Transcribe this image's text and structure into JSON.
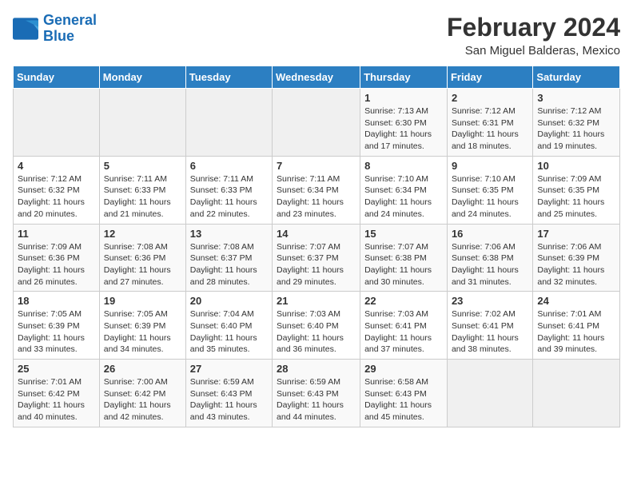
{
  "logo": {
    "line1": "General",
    "line2": "Blue"
  },
  "title": "February 2024",
  "location": "San Miguel Balderas, Mexico",
  "days_header": [
    "Sunday",
    "Monday",
    "Tuesday",
    "Wednesday",
    "Thursday",
    "Friday",
    "Saturday"
  ],
  "weeks": [
    [
      {
        "day": "",
        "info": ""
      },
      {
        "day": "",
        "info": ""
      },
      {
        "day": "",
        "info": ""
      },
      {
        "day": "",
        "info": ""
      },
      {
        "day": "1",
        "info": "Sunrise: 7:13 AM\nSunset: 6:30 PM\nDaylight: 11 hours and 17 minutes."
      },
      {
        "day": "2",
        "info": "Sunrise: 7:12 AM\nSunset: 6:31 PM\nDaylight: 11 hours and 18 minutes."
      },
      {
        "day": "3",
        "info": "Sunrise: 7:12 AM\nSunset: 6:32 PM\nDaylight: 11 hours and 19 minutes."
      }
    ],
    [
      {
        "day": "4",
        "info": "Sunrise: 7:12 AM\nSunset: 6:32 PM\nDaylight: 11 hours and 20 minutes."
      },
      {
        "day": "5",
        "info": "Sunrise: 7:11 AM\nSunset: 6:33 PM\nDaylight: 11 hours and 21 minutes."
      },
      {
        "day": "6",
        "info": "Sunrise: 7:11 AM\nSunset: 6:33 PM\nDaylight: 11 hours and 22 minutes."
      },
      {
        "day": "7",
        "info": "Sunrise: 7:11 AM\nSunset: 6:34 PM\nDaylight: 11 hours and 23 minutes."
      },
      {
        "day": "8",
        "info": "Sunrise: 7:10 AM\nSunset: 6:34 PM\nDaylight: 11 hours and 24 minutes."
      },
      {
        "day": "9",
        "info": "Sunrise: 7:10 AM\nSunset: 6:35 PM\nDaylight: 11 hours and 24 minutes."
      },
      {
        "day": "10",
        "info": "Sunrise: 7:09 AM\nSunset: 6:35 PM\nDaylight: 11 hours and 25 minutes."
      }
    ],
    [
      {
        "day": "11",
        "info": "Sunrise: 7:09 AM\nSunset: 6:36 PM\nDaylight: 11 hours and 26 minutes."
      },
      {
        "day": "12",
        "info": "Sunrise: 7:08 AM\nSunset: 6:36 PM\nDaylight: 11 hours and 27 minutes."
      },
      {
        "day": "13",
        "info": "Sunrise: 7:08 AM\nSunset: 6:37 PM\nDaylight: 11 hours and 28 minutes."
      },
      {
        "day": "14",
        "info": "Sunrise: 7:07 AM\nSunset: 6:37 PM\nDaylight: 11 hours and 29 minutes."
      },
      {
        "day": "15",
        "info": "Sunrise: 7:07 AM\nSunset: 6:38 PM\nDaylight: 11 hours and 30 minutes."
      },
      {
        "day": "16",
        "info": "Sunrise: 7:06 AM\nSunset: 6:38 PM\nDaylight: 11 hours and 31 minutes."
      },
      {
        "day": "17",
        "info": "Sunrise: 7:06 AM\nSunset: 6:39 PM\nDaylight: 11 hours and 32 minutes."
      }
    ],
    [
      {
        "day": "18",
        "info": "Sunrise: 7:05 AM\nSunset: 6:39 PM\nDaylight: 11 hours and 33 minutes."
      },
      {
        "day": "19",
        "info": "Sunrise: 7:05 AM\nSunset: 6:39 PM\nDaylight: 11 hours and 34 minutes."
      },
      {
        "day": "20",
        "info": "Sunrise: 7:04 AM\nSunset: 6:40 PM\nDaylight: 11 hours and 35 minutes."
      },
      {
        "day": "21",
        "info": "Sunrise: 7:03 AM\nSunset: 6:40 PM\nDaylight: 11 hours and 36 minutes."
      },
      {
        "day": "22",
        "info": "Sunrise: 7:03 AM\nSunset: 6:41 PM\nDaylight: 11 hours and 37 minutes."
      },
      {
        "day": "23",
        "info": "Sunrise: 7:02 AM\nSunset: 6:41 PM\nDaylight: 11 hours and 38 minutes."
      },
      {
        "day": "24",
        "info": "Sunrise: 7:01 AM\nSunset: 6:41 PM\nDaylight: 11 hours and 39 minutes."
      }
    ],
    [
      {
        "day": "25",
        "info": "Sunrise: 7:01 AM\nSunset: 6:42 PM\nDaylight: 11 hours and 40 minutes."
      },
      {
        "day": "26",
        "info": "Sunrise: 7:00 AM\nSunset: 6:42 PM\nDaylight: 11 hours and 42 minutes."
      },
      {
        "day": "27",
        "info": "Sunrise: 6:59 AM\nSunset: 6:43 PM\nDaylight: 11 hours and 43 minutes."
      },
      {
        "day": "28",
        "info": "Sunrise: 6:59 AM\nSunset: 6:43 PM\nDaylight: 11 hours and 44 minutes."
      },
      {
        "day": "29",
        "info": "Sunrise: 6:58 AM\nSunset: 6:43 PM\nDaylight: 11 hours and 45 minutes."
      },
      {
        "day": "",
        "info": ""
      },
      {
        "day": "",
        "info": ""
      }
    ]
  ]
}
